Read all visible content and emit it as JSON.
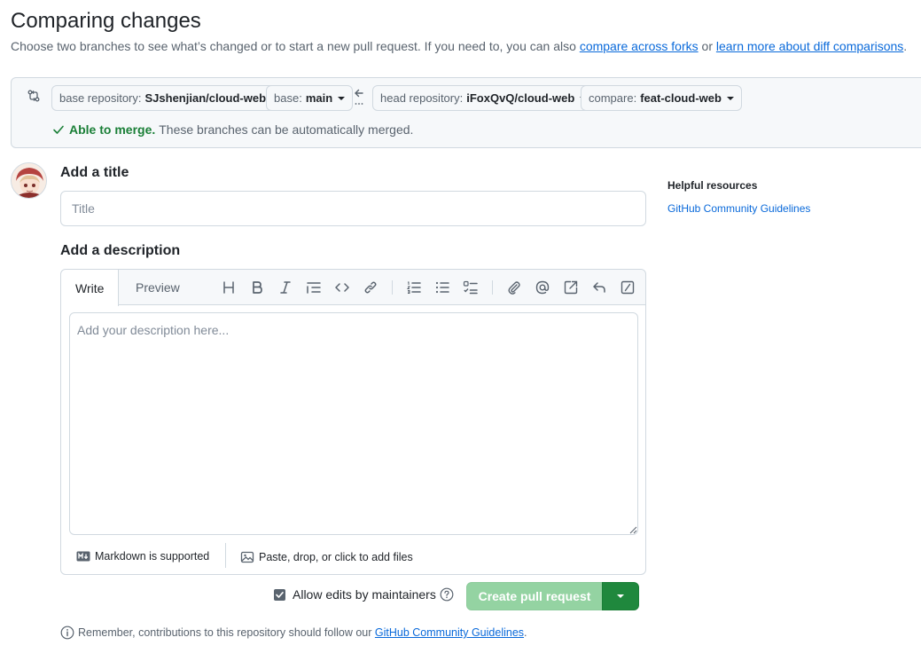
{
  "page": {
    "title": "Comparing changes",
    "subtitle_prefix": "Choose two branches to see what’s changed or to start a new pull request. If you need to, you can also",
    "subtitle_link1": "compare across forks",
    "subtitle_mid": "or",
    "subtitle_link2": "learn more about diff comparisons",
    "subtitle_suffix": "."
  },
  "range": {
    "base_repo_label": "base repository:",
    "base_repo_value": "SJshenjian/cloud-web",
    "base_label": "base:",
    "base_value": "main",
    "head_repo_label": "head repository:",
    "head_repo_value": "iFoxQvQ/cloud-web",
    "compare_label": "compare:",
    "compare_value": "feat-cloud-web",
    "merge_status": "Able to merge.",
    "merge_detail": "These branches can be automatically merged."
  },
  "form": {
    "title_label": "Add a title",
    "title_placeholder": "Title",
    "description_label": "Add a description",
    "tab_write": "Write",
    "tab_preview": "Preview",
    "description_placeholder": "Add your description here...",
    "markdown_note": "Markdown is supported",
    "attach_note": "Paste, drop, or click to add files",
    "allow_edits": "Allow edits by maintainers",
    "create_button": "Create pull request",
    "remember_prefix": "Remember, contributions to this repository should follow our",
    "remember_link": "GitHub Community Guidelines",
    "remember_suffix": "."
  },
  "sidebar": {
    "title": "Helpful resources",
    "link": "GitHub Community Guidelines"
  },
  "colors": {
    "link": "#0969da",
    "success": "#1a7f37",
    "primary_button": "#1f883d",
    "primary_button_disabled": "#94d3a2"
  },
  "toolbar_icons": [
    "heading-icon",
    "bold-icon",
    "italic-icon",
    "quote-icon",
    "code-icon",
    "link-icon",
    "ordered-list-icon",
    "unordered-list-icon",
    "task-list-icon",
    "attach-icon",
    "mention-icon",
    "reference-icon",
    "saved-reply-icon",
    "slash-command-icon"
  ]
}
